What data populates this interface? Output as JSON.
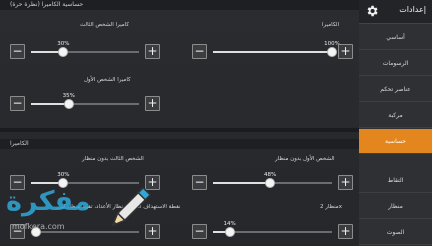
{
  "sidebar": {
    "title": "إعدادات",
    "icon": "gear-icon",
    "items": [
      {
        "label": "أساسي",
        "active": false
      },
      {
        "label": "الرسومات",
        "active": false
      },
      {
        "label": "عناصر تحكم",
        "active": false
      },
      {
        "label": "مركبة",
        "active": false
      },
      {
        "label": "حساسية",
        "active": true
      },
      {
        "label": "التقاط",
        "active": false
      },
      {
        "label": "منظار",
        "active": false
      },
      {
        "label": "الصوت",
        "active": false
      }
    ]
  },
  "sections": {
    "free_look": {
      "title": "حساسية الكاميرا (نظرة حرة)"
    },
    "camera": {
      "title": "الكاميرا"
    }
  },
  "settings": {
    "tpp_camera": {
      "label": "كاميرا الشخص الثالث",
      "value": "30%",
      "fraction": 0.3
    },
    "camera": {
      "label": "الكاميرا",
      "value": "100%",
      "fraction": 1.0
    },
    "fpp_camera": {
      "label": "كاميرا الشخص الأول",
      "value": "35%",
      "fraction": 0.35
    },
    "tpp_no_scope": {
      "label": "الشخص الثالث بدون منظار",
      "value": "30%",
      "fraction": 0.3
    },
    "fpp_no_scope": {
      "label": "الشخص الأول بدون منظار",
      "value": "48%",
      "fraction": 0.48
    },
    "red_dot": {
      "label": "نقطة الاستهداف المائل منظار الأعداد، تقييد منظار ليزر",
      "value": "",
      "fraction": 0.05
    },
    "scope_2x": {
      "label": "منظار 2x",
      "value": "14%",
      "fraction": 0.14
    }
  },
  "buttons": {
    "minus": "−",
    "plus": "+"
  },
  "watermark": {
    "text": "مفكرة",
    "sub": "mofkera.com"
  },
  "colors": {
    "accent": "#e3861d",
    "watermark": "#2fa8d8"
  }
}
